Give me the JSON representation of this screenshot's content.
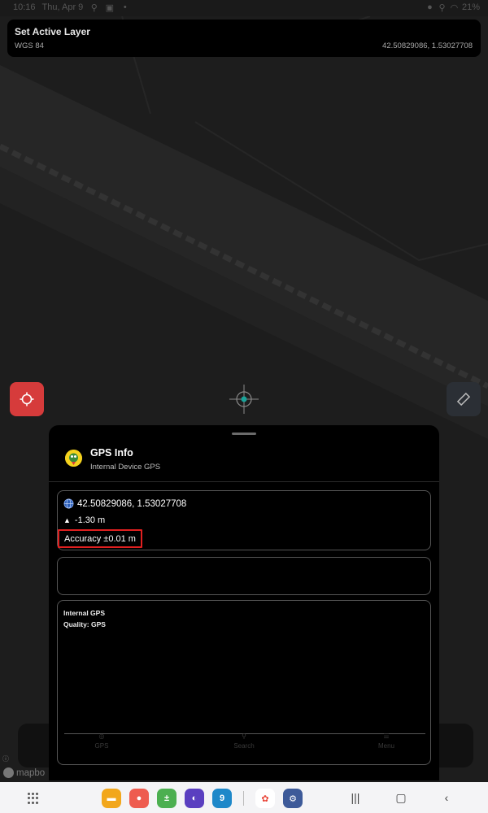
{
  "status_bar": {
    "time": "10:16",
    "date": "Thu, Apr 9",
    "battery": "21%"
  },
  "layer_card": {
    "title": "Set Active Layer",
    "datum": "WGS 84",
    "coordinates": "42.50829086, 1.53027708"
  },
  "gps_sheet": {
    "title": "GPS Info",
    "subtitle": "Internal Device GPS",
    "coordinates": "42.50829086, 1.53027708",
    "altitude": "-1.30 m",
    "accuracy": "Accuracy ±0.01 m",
    "details": [
      "Internal GPS",
      "Quality: GPS"
    ],
    "ghost_tabs": [
      "GPS",
      "Search",
      "Menu"
    ]
  },
  "attribution": {
    "brand": "mapbo"
  },
  "colors": {
    "locate_button": "#d63b3b",
    "highlight": "#e02020",
    "gps_logo": "#f4d21e",
    "crosshair_dot": "#1aa39a"
  },
  "nav_dock": {
    "calendar_day": "9"
  }
}
